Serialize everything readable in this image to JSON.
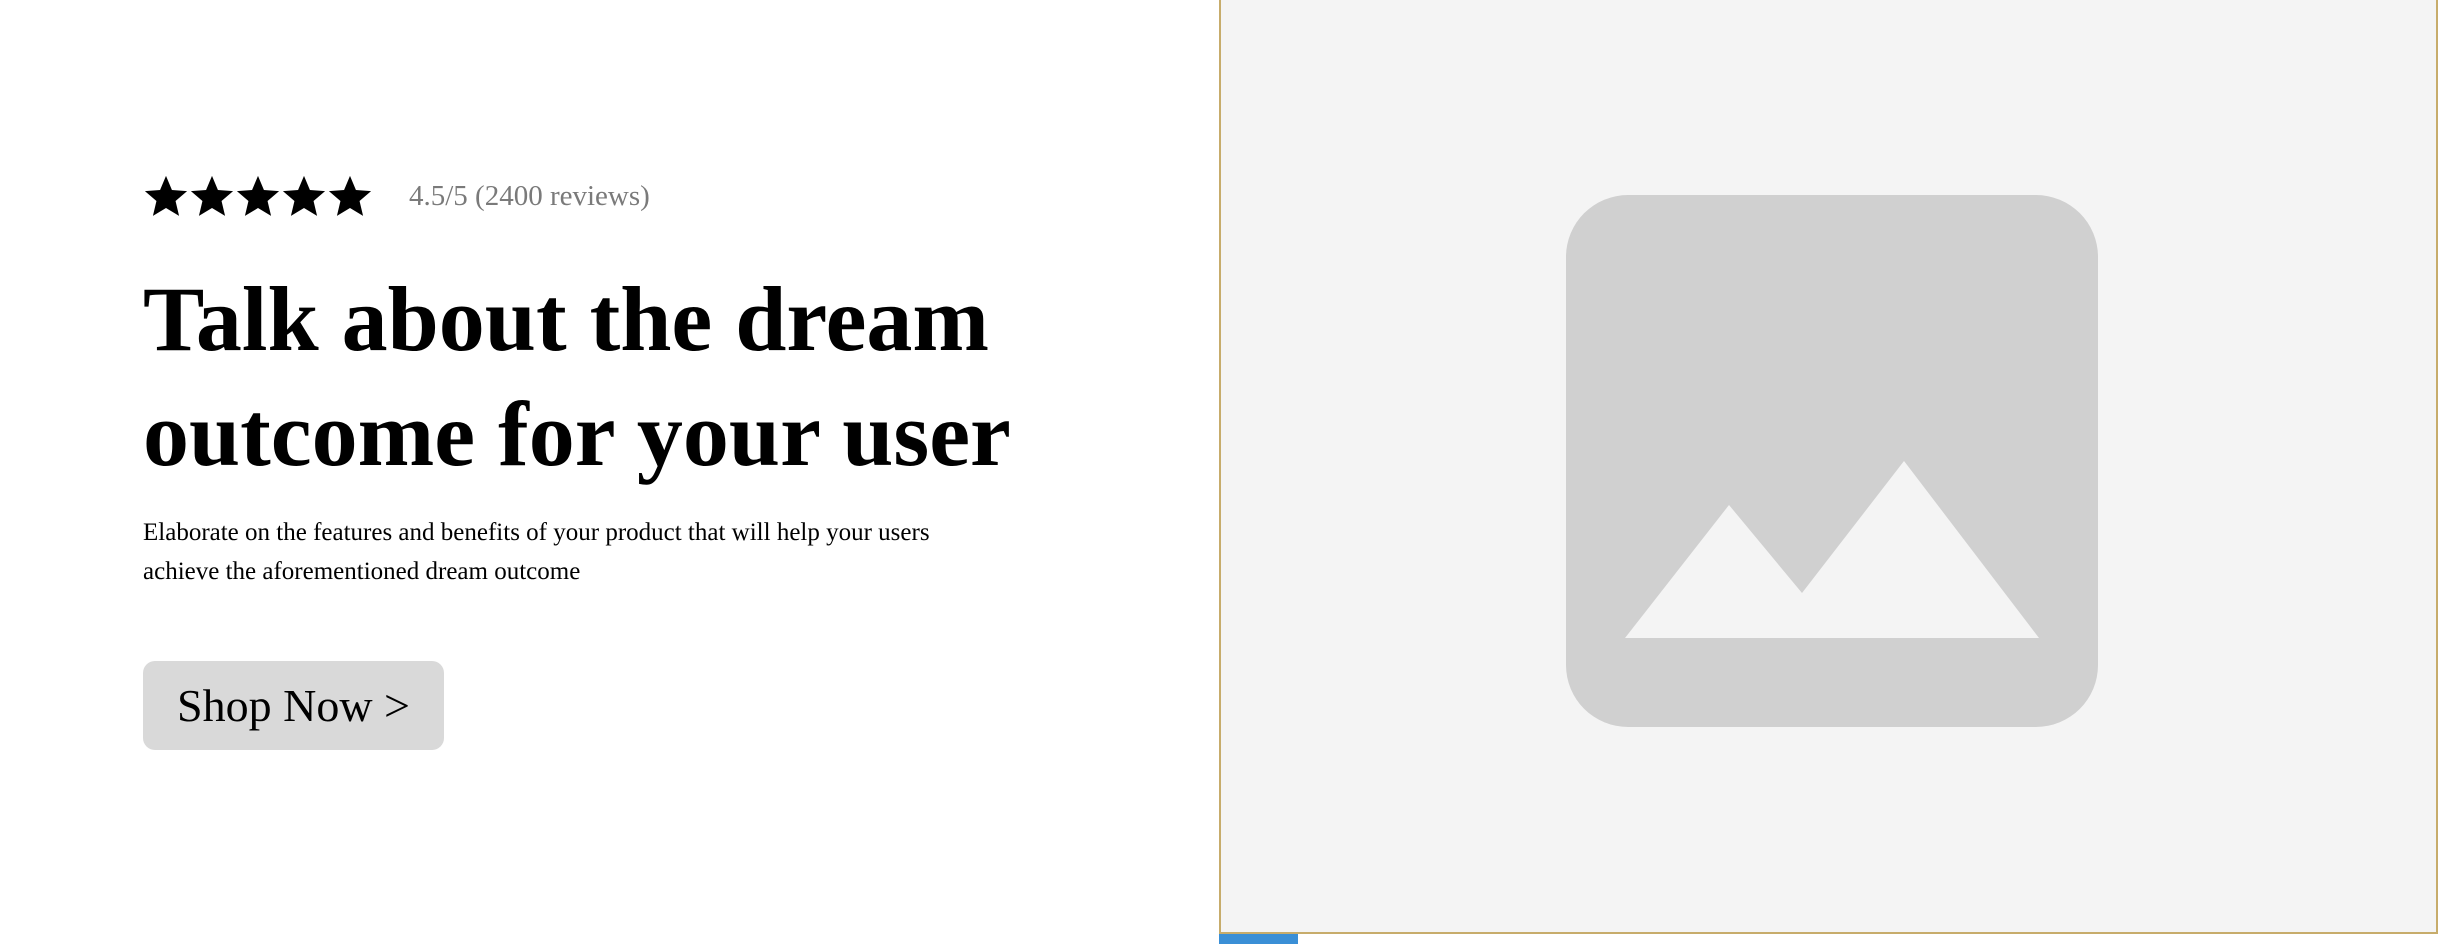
{
  "hero": {
    "rating": {
      "stars": 5,
      "icon": "star-icon",
      "text": "4.5/5 (2400 reviews)"
    },
    "headline_line1": "Talk about the dream",
    "headline_line2": "outcome for your user",
    "description_line1": "Elaborate on the features and benefits of your product that will help your users",
    "description_line2": "achieve the aforementioned dream outcome",
    "cta_label": "Shop Now >"
  },
  "media": {
    "icon": "image-placeholder-icon"
  },
  "colors": {
    "background": "#ffffff",
    "rating_text": "#7a7a7a",
    "button_bg": "#d9d9d9",
    "media_bg": "#f4f4f4",
    "media_border": "#c7ac6b",
    "placeholder_icon": "#d0d0d0",
    "accent_tab": "#3a8fd6"
  }
}
